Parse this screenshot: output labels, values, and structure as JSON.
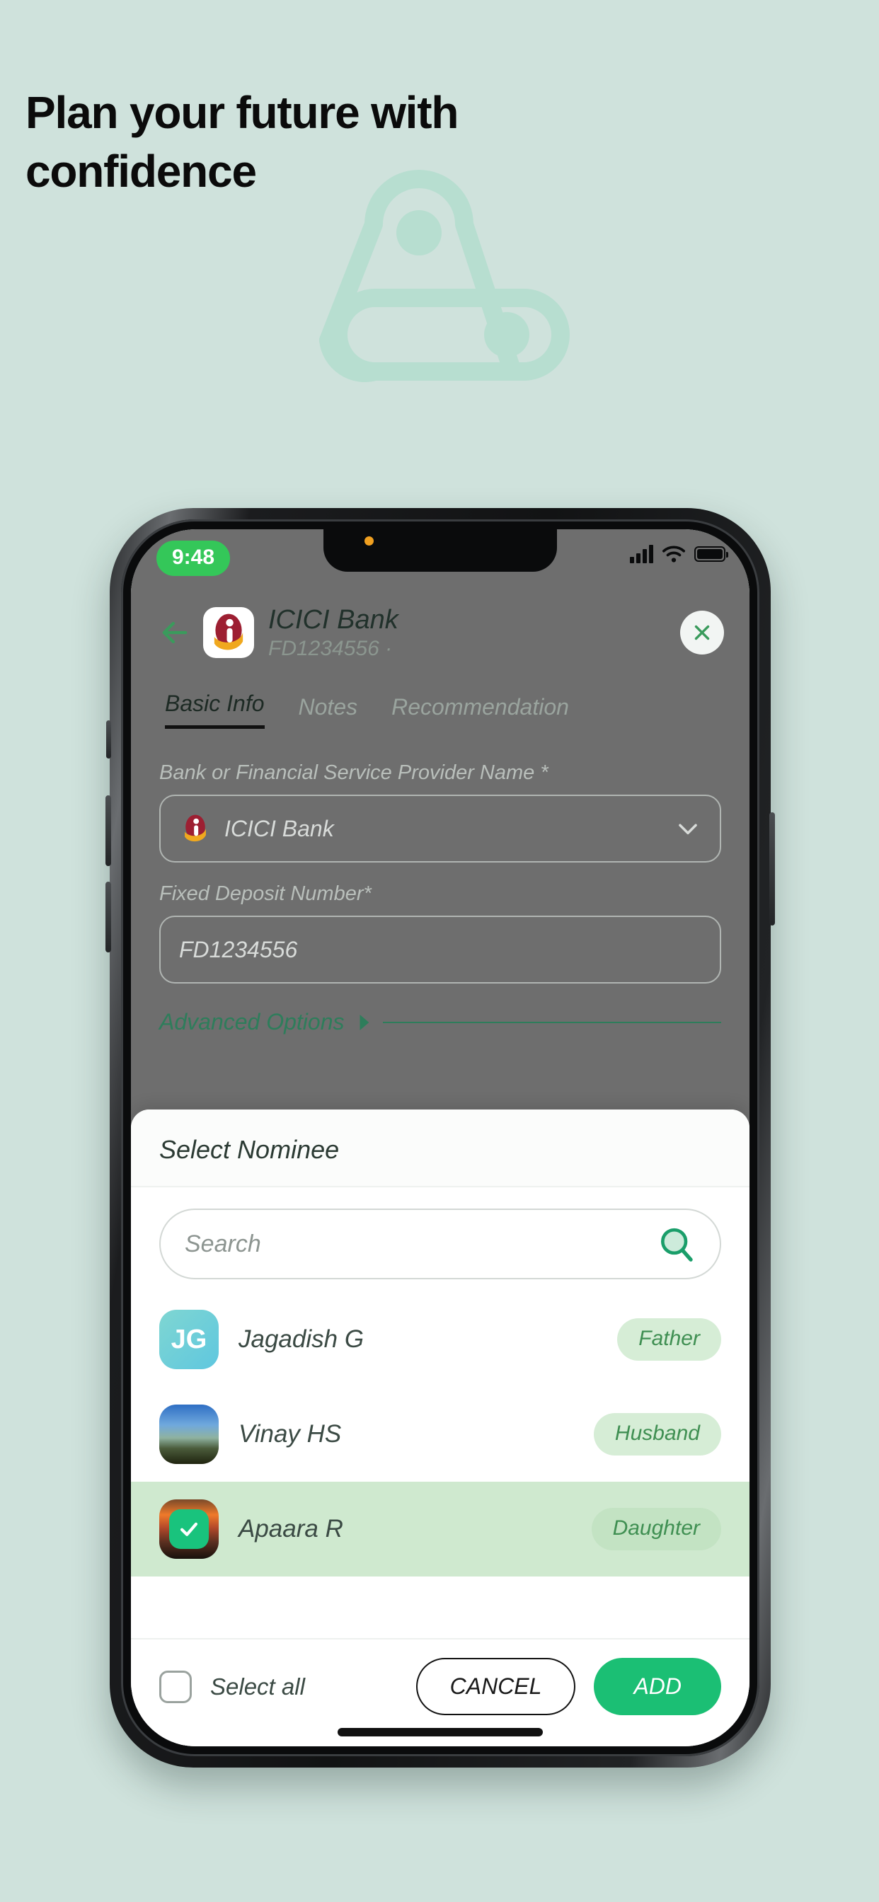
{
  "theme": {
    "background": "#cfe2dc",
    "accent_green": "#1bbf74",
    "dark_green": "#2e7d5b",
    "chip_green_bg": "#d6edd6",
    "selected_row_bg": "#cfe9cf"
  },
  "hero": {
    "headline": "Plan your future with confidence",
    "watermark_icon": "brand-logo-watermark"
  },
  "phone": {
    "statusbar": {
      "time": "9:48",
      "signal_icon": "cellular-signal-icon",
      "wifi_icon": "wifi-icon",
      "battery_icon": "battery-full-icon",
      "notification_dot": "orange-dot-indicator"
    },
    "appbar": {
      "back_icon": "back-arrow-icon",
      "bank_logo_icon": "icici-bank-logo-icon",
      "title": "ICICI Bank",
      "subtitle": "FD1234556 ·",
      "close_icon": "close-x-icon"
    },
    "tabs": [
      {
        "label": "Basic Info",
        "active": true
      },
      {
        "label": "Notes",
        "active": false
      },
      {
        "label": "Recommendation",
        "active": false
      }
    ],
    "form": {
      "provider": {
        "label": "Bank or Financial Service Provider Name *",
        "value": "ICICI Bank",
        "logo_icon": "icici-bank-logo-icon",
        "chevron_icon": "chevron-down-icon"
      },
      "deposit": {
        "label": "Fixed Deposit Number*",
        "value": "FD1234556"
      },
      "advanced_options": {
        "label": "Advanced Options",
        "caret_icon": "caret-right-icon"
      }
    },
    "sheet": {
      "title": "Select Nominee",
      "search": {
        "placeholder": "Search",
        "value": "",
        "icon": "search-icon"
      },
      "nominees": [
        {
          "name": "Jagadish G",
          "relation": "Father",
          "avatar_type": "initials",
          "initials": "JG",
          "selected": false
        },
        {
          "name": "Vinay HS",
          "relation": "Husband",
          "avatar_type": "photo-mountain",
          "initials": "",
          "selected": false
        },
        {
          "name": "Apaara R",
          "relation": "Daughter",
          "avatar_type": "photo-sunset",
          "initials": "",
          "selected": true
        }
      ],
      "footer": {
        "select_all_label": "Select all",
        "select_all_checked": false,
        "cancel_label": "CANCEL",
        "add_label": "ADD"
      }
    }
  }
}
